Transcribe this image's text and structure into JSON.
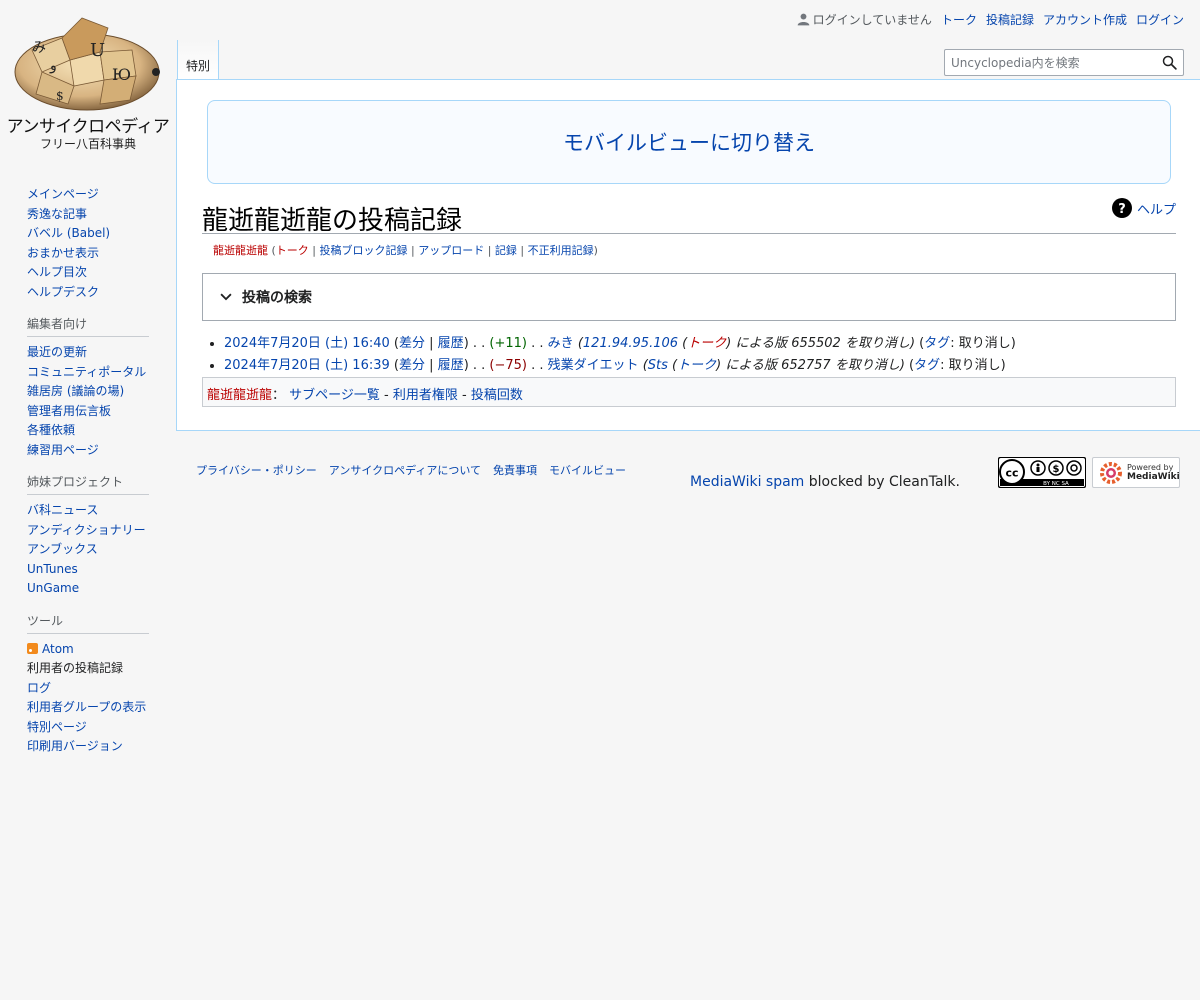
{
  "logo": {
    "wordmark": "アンサイクロペディア",
    "tagline": "フリー八百科事典"
  },
  "personal": {
    "not_logged_in": "ログインしていません",
    "links": [
      "トーク",
      "投稿記録",
      "アカウント作成",
      "ログイン"
    ]
  },
  "tabs": {
    "special": "特別"
  },
  "search": {
    "placeholder": "Uncyclopedia内を検索"
  },
  "sidebar": {
    "main": [
      "メインページ",
      "秀逸な記事",
      "バベル (Babel)",
      "おまかせ表示",
      "ヘルプ目次",
      "ヘルプデスク"
    ],
    "editors": {
      "heading": "編集者向け",
      "items": [
        "最近の更新",
        "コミュニティポータル",
        "雑居房 (議論の場)",
        "管理者用伝言板",
        "各種依頼",
        "練習用ページ"
      ]
    },
    "sister": {
      "heading": "姉妹プロジェクト",
      "items": [
        "バ科ニュース",
        "アンディクショナリー",
        "アンブックス",
        "UnTunes",
        "UnGame"
      ]
    },
    "tools": {
      "heading": "ツール",
      "items": [
        "Atom",
        "利用者の投稿記録",
        "ログ",
        "利用者グループの表示",
        "特別ページ",
        "印刷用バージョン"
      ]
    }
  },
  "mobile_switch": "モバイルビューに切り替え",
  "page_title": "龍逝龍逝龍の投稿記録",
  "help_label": "ヘルプ",
  "subtitle": {
    "user": "龍逝龍逝龍",
    "talk": "トーク",
    "block_log": "投稿ブロック記録",
    "uploads": "アップロード",
    "logs": "記録",
    "abuse_log": "不正利用記録"
  },
  "contrib_search_label": "投稿の検索",
  "contributions": [
    {
      "date": "2024年7月20日 (土) 16:40",
      "diff": "差分",
      "hist": "履歴",
      "size": "(+11)",
      "size_class": "pos",
      "page": "みき",
      "summary_pre": "(",
      "summary_user": "121.94.95.106",
      "summary_talk": "トーク",
      "summary_post": ") による版 655502 を取り消し)",
      "tag_label": "タグ",
      "tag_value": ": 取り消し)"
    },
    {
      "date": "2024年7月20日 (土) 16:39",
      "diff": "差分",
      "hist": "履歴",
      "size": "(−75)",
      "size_class": "neg",
      "page": "残業ダイエット",
      "summary_pre": "(",
      "summary_user": "Sts",
      "summary_talk": "トーク",
      "summary_post": ") による版 652757 を取り消し)",
      "tag_label": "タグ",
      "tag_value": ": 取り消し)"
    }
  ],
  "user_links": {
    "user": "龍逝龍逝龍",
    "subpages": "サブページ一覧",
    "rights": "利用者権限",
    "editcount": "投稿回数"
  },
  "footer": {
    "places": [
      "プライバシー・ポリシー",
      "アンサイクロペディアについて",
      "免責事項",
      "モバイルビュー"
    ],
    "cleantalk_link": "MediaWiki spam",
    "cleantalk_text": " blocked by CleanTalk.",
    "cc_text": "BY NC SA",
    "mw_line1": "Powered by",
    "mw_line2": "MediaWiki"
  },
  "colors": {
    "link": "#0645ad",
    "redlink": "#ba0000",
    "border": "#a7d7f9"
  }
}
